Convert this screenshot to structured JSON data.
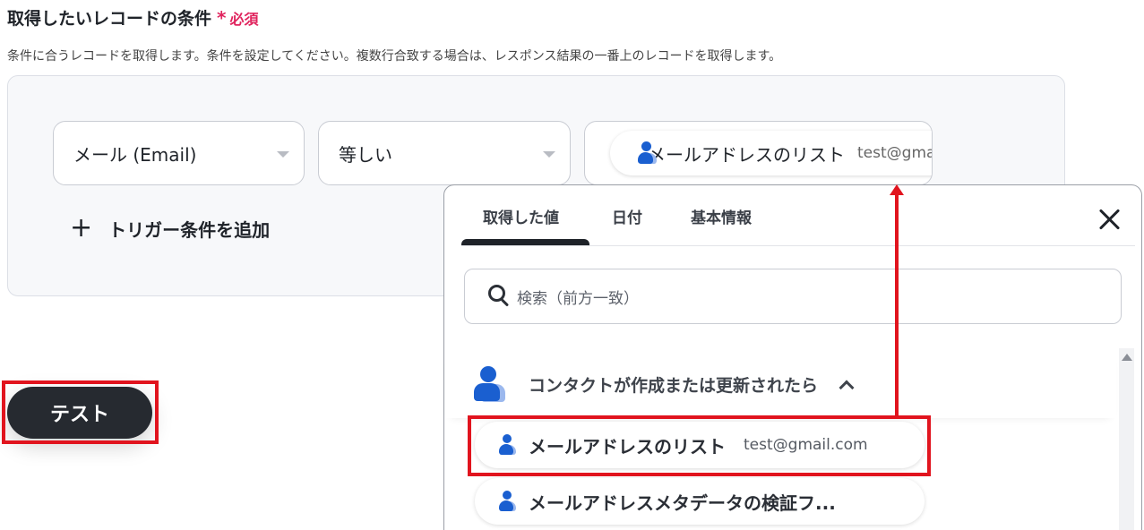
{
  "section": {
    "title": "取得したいレコードの条件",
    "required_mark": "*",
    "required_label": "必須",
    "description": "条件に合うレコードを取得します。条件を設定してください。複数行合致する場合は、レスポンス結果の一番上のレコードを取得します。"
  },
  "condition": {
    "field_select": "メール (Email)",
    "operator_select": "等しい",
    "value_chip": {
      "label": "メールアドレスのリスト",
      "value": "test@gmail.com"
    },
    "add_label": "トリガー条件を追加",
    "add_icon": "plus-icon"
  },
  "test_button": {
    "label": "テスト"
  },
  "popup": {
    "tabs": [
      "取得した値",
      "日付",
      "基本情報"
    ],
    "active_tab": "取得した値",
    "search_placeholder": "検索（前方一致）",
    "group": {
      "label": "コンタクトが作成または更新されたら",
      "icon": "person-icon",
      "expanded": true
    },
    "items": [
      {
        "label": "メールアドレスのリスト",
        "value": "test@gmail.com"
      },
      {
        "label": "メールアドレスメタデータの検証フ...",
        "value": ""
      }
    ]
  },
  "colors": {
    "accent_red": "#e1141e",
    "required_pink": "#e0245e",
    "primary_dark": "#262a30",
    "icon_blue": "#1a5fd0"
  }
}
